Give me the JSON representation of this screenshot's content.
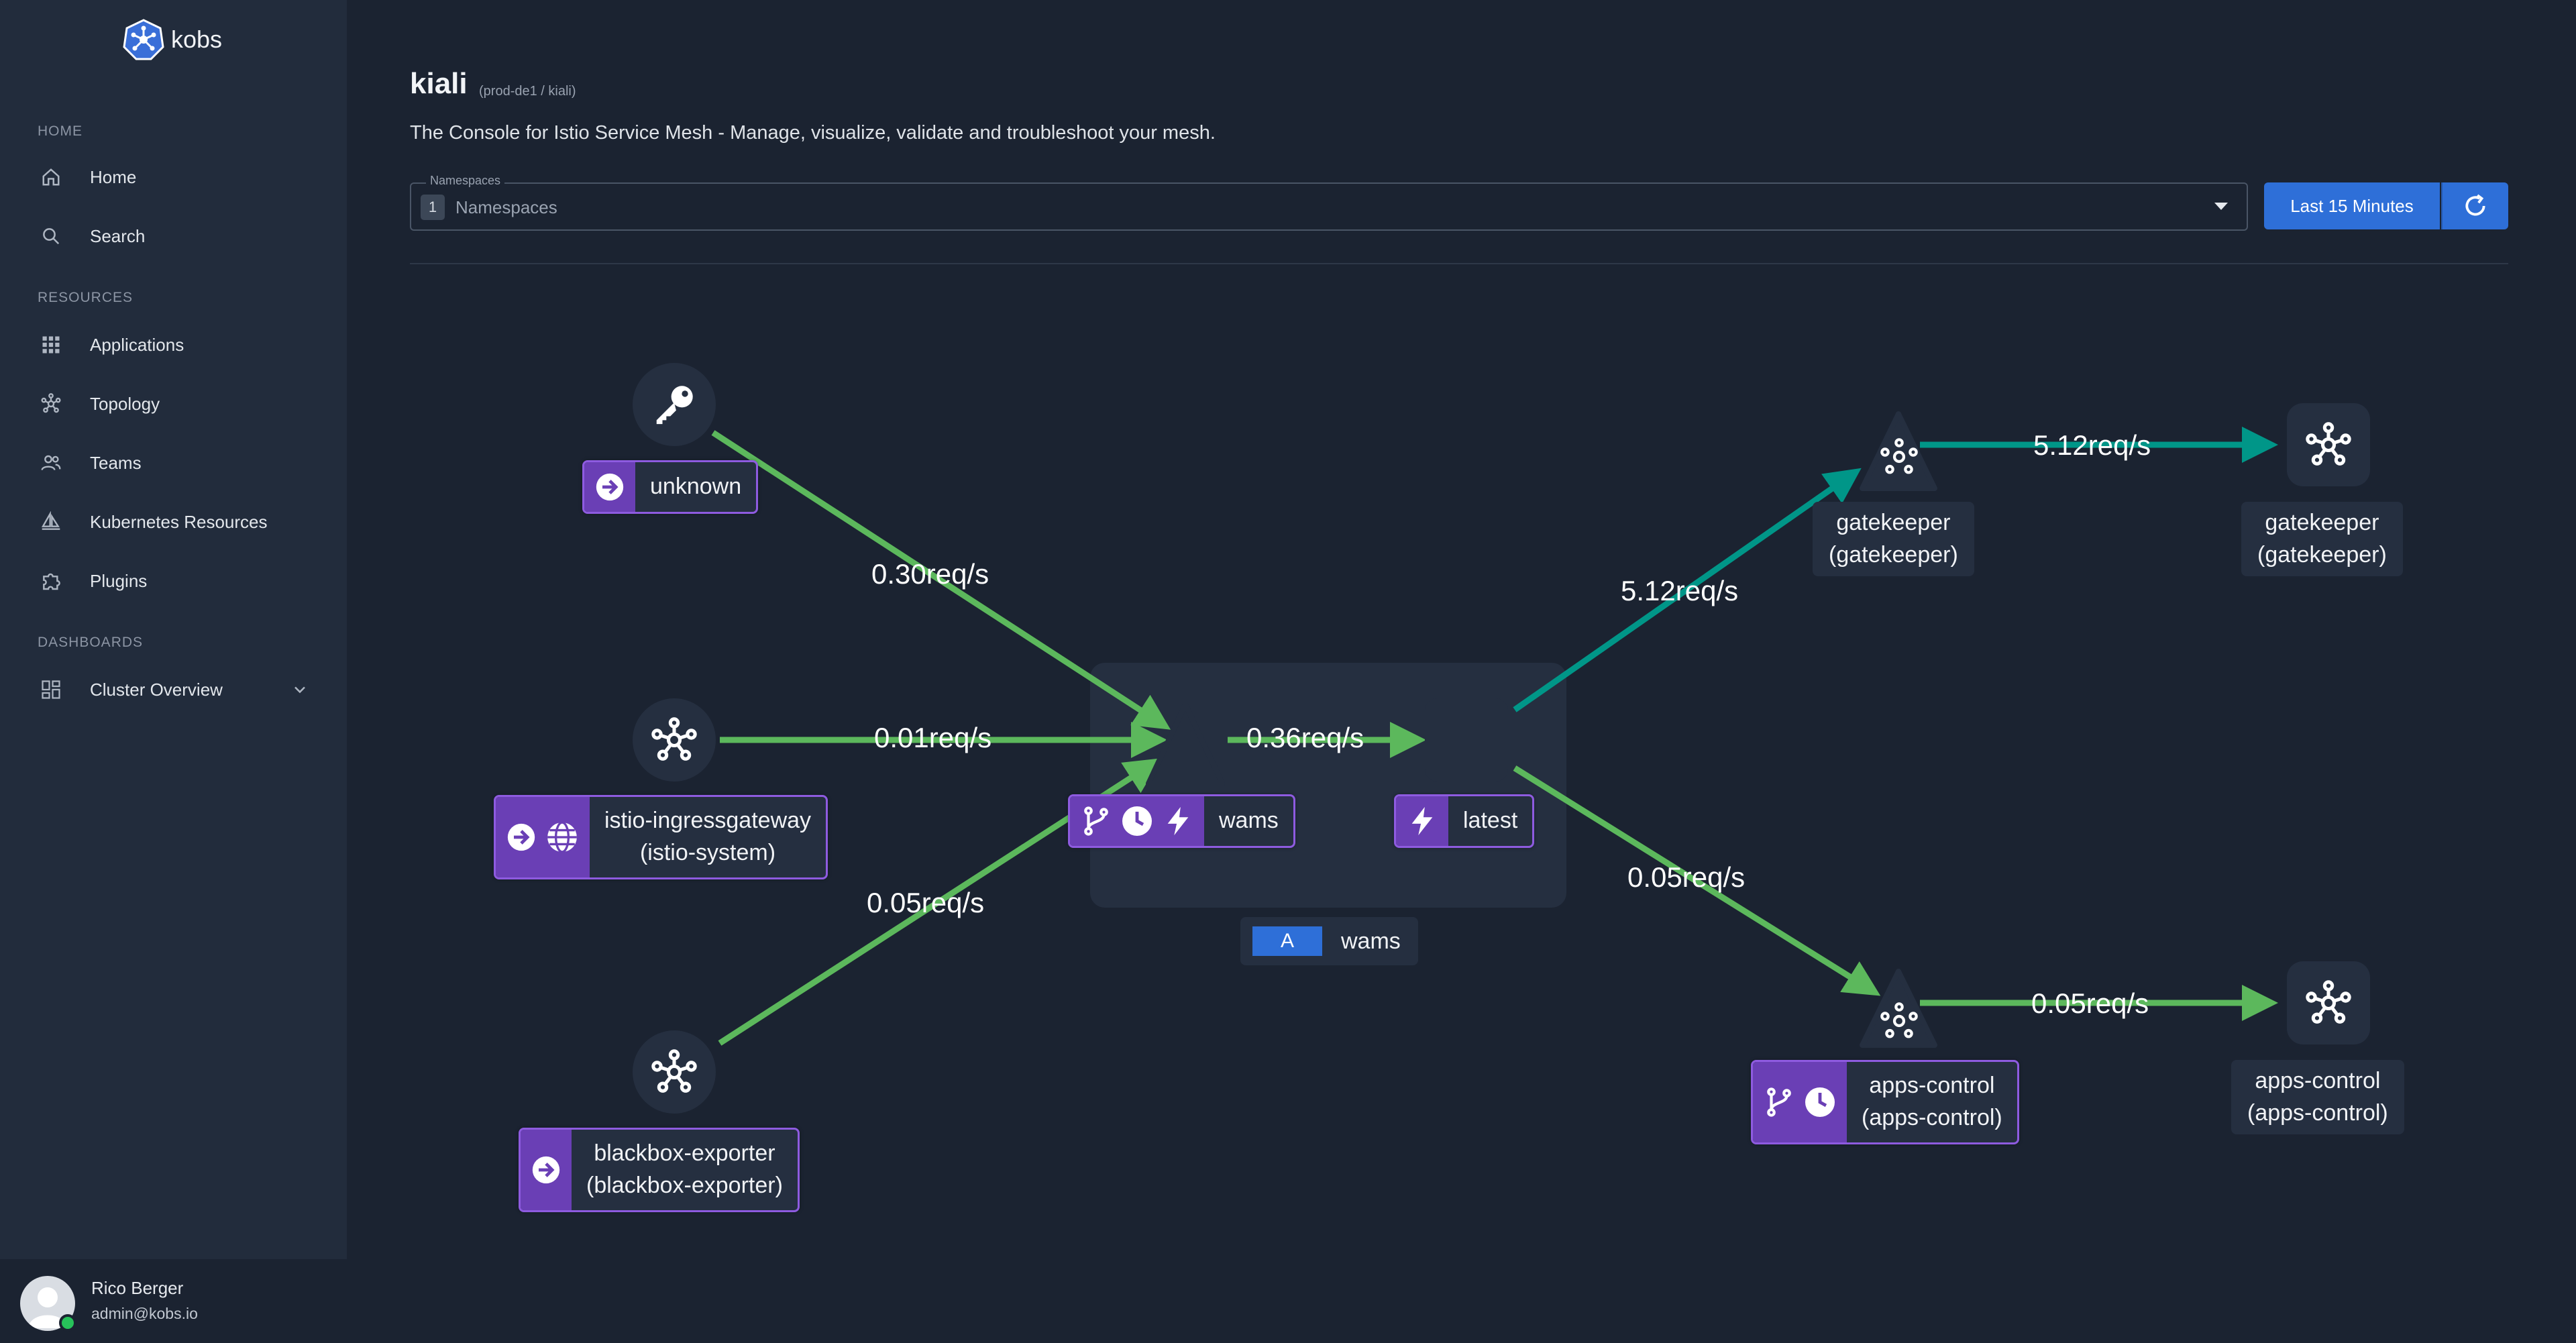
{
  "app": {
    "name": "kobs"
  },
  "sidebar": {
    "sections": {
      "home": "HOME",
      "resources": "RESOURCES",
      "dashboards": "DASHBOARDS"
    },
    "items": [
      {
        "label": "Home",
        "icon": "home-icon"
      },
      {
        "label": "Search",
        "icon": "search-icon"
      },
      {
        "label": "Applications",
        "icon": "grid-icon"
      },
      {
        "label": "Topology",
        "icon": "topology-icon"
      },
      {
        "label": "Teams",
        "icon": "team-icon"
      },
      {
        "label": "Kubernetes Resources",
        "icon": "kubernetes-icon"
      },
      {
        "label": "Plugins",
        "icon": "puzzle-icon"
      },
      {
        "label": "Cluster Overview",
        "icon": "dashboard-icon"
      }
    ],
    "user": {
      "name": "Rico Berger",
      "email": "admin@kobs.io",
      "status": "online"
    }
  },
  "page": {
    "title": "kiali",
    "subtitle": "(prod-de1 / kiali)",
    "description": "The Console for Istio Service Mesh - Manage, visualize, validate and troubleshoot your mesh."
  },
  "filters": {
    "namespaces_legend": "Namespaces",
    "namespaces_count": "1",
    "namespaces_placeholder": "Namespaces",
    "time_button": "Last 15 Minutes"
  },
  "graph": {
    "nodes": {
      "unknown": "unknown",
      "istio_line1": "istio-ingressgateway",
      "istio_line2": "(istio-system)",
      "blackbox_line1": "blackbox-exporter",
      "blackbox_line2": "(blackbox-exporter)",
      "wams": "wams",
      "latest": "latest",
      "group_badge": "A",
      "group_name": "wams",
      "gk_app_line1": "gatekeeper",
      "gk_app_line2": "(gatekeeper)",
      "gk_svc_line1": "gatekeeper",
      "gk_svc_line2": "(gatekeeper)",
      "ac_app_line1": "apps-control",
      "ac_app_line2": "(apps-control)",
      "ac_svc_line1": "apps-control",
      "ac_svc_line2": "(apps-control)"
    },
    "edges": {
      "unknown_wams": "0.30req/s",
      "istio_wams": "0.01req/s",
      "wams_latest": "0.36req/s",
      "blackbox_wams": "0.05req/s",
      "latest_gatekeeper": "5.12req/s",
      "gatekeeper_svc": "5.12req/s",
      "latest_apps": "0.05req/s",
      "apps_svc": "0.05req/s"
    },
    "colors": {
      "healthy": "#5cb85c",
      "tcp": "#009688",
      "badge": "#6a3fb5",
      "badge_border": "#8e5be0",
      "accent": "#2e6fd8"
    }
  }
}
